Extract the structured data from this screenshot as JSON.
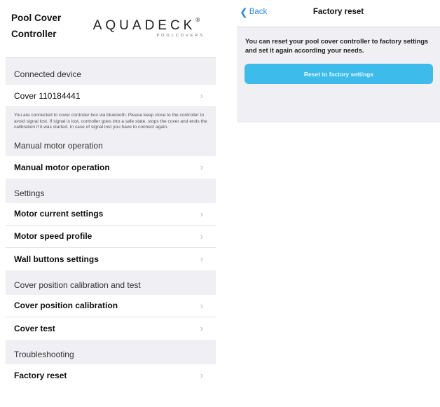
{
  "left_screen": {
    "header": {
      "title": "Pool Cover Controller",
      "brand_name": "AQUADECK",
      "brand_registered": "®",
      "brand_subtitle": "POOLCOVERS"
    },
    "sections": [
      {
        "title": "Connected device",
        "rows": [
          {
            "label": "Cover 110184441"
          }
        ]
      },
      {
        "title": "Manual motor operation",
        "rows": [
          {
            "label": "Manual motor operation"
          }
        ]
      },
      {
        "title": "Settings",
        "rows": [
          {
            "label": "Motor current settings"
          },
          {
            "label": "Motor speed profile"
          },
          {
            "label": "Wall buttons settings"
          }
        ]
      },
      {
        "title": "Cover position calibration and test",
        "rows": [
          {
            "label": "Cover position calibration"
          },
          {
            "label": "Cover test"
          }
        ]
      },
      {
        "title": "Troubleshooting",
        "rows": [
          {
            "label": "Factory reset"
          }
        ]
      }
    ],
    "connected_info": "You are connected to cover controler box via bluetooth. Please keep close to the controller to avoid signal lost. If signal is lost, controller goes into a safe state, stops the cover and ends the calibration if it was started. In case of signal lost you have to connect again.",
    "chevron_icon": "chevron-right-icon"
  },
  "right_screen": {
    "nav": {
      "back_label": "Back",
      "title": "Factory reset"
    },
    "description": "You can reset your pool cover controller to factory settings and set it again according your needs.",
    "reset_button_label": "Reset to factory settings",
    "colors": {
      "accent": "#3dbcec",
      "link": "#2f8de4",
      "background": "#efeff4"
    }
  }
}
